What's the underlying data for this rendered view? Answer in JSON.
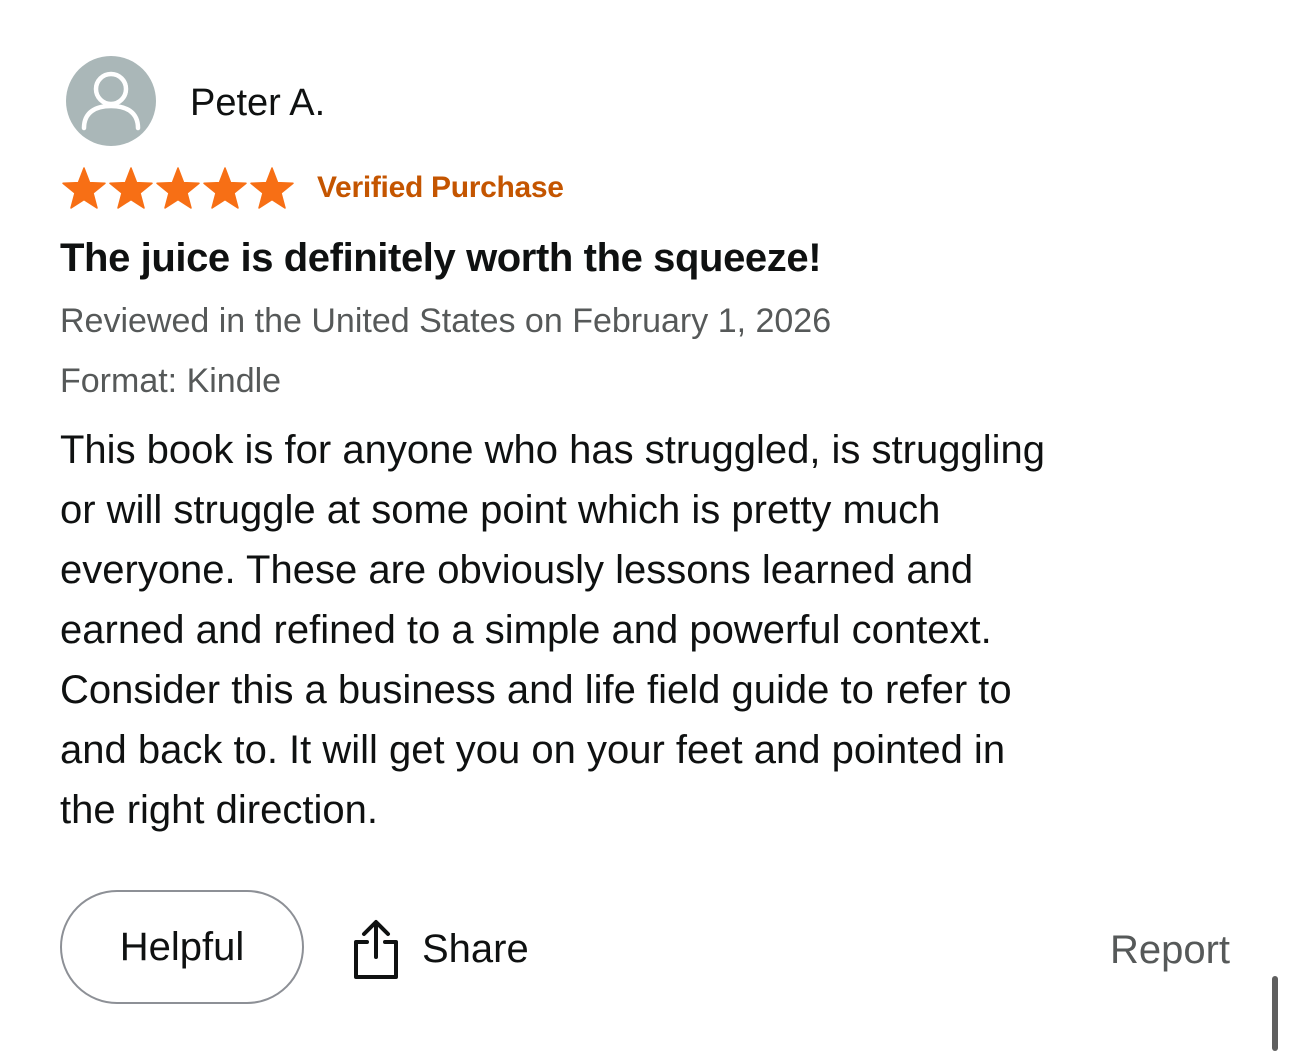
{
  "review": {
    "reviewer_name": "Peter A.",
    "avatar_icon": "person-silhouette-icon",
    "rating": 5,
    "rating_max": 5,
    "star_icon": "star-icon",
    "star_color": "#f76f15",
    "verified_label": "Verified Purchase",
    "verified_color": "#c45500",
    "title": "The juice is definitely worth the squeeze!",
    "date_line": "Reviewed in the United States on February 1, 2026",
    "format_line": "Format: Kindle",
    "body_lines": [
      "This book is for anyone who has struggled, is struggling",
      "or will struggle at some point which is pretty much",
      "everyone. These are obviously lessons learned and",
      "earned and refined to a simple and powerful context.",
      "Consider this a business and life field guide to refer to",
      "and back to. It will get you on your feet and pointed in",
      "the right direction."
    ]
  },
  "actions": {
    "helpful_label": "Helpful",
    "share_label": "Share",
    "share_icon": "share-icon",
    "report_label": "Report"
  }
}
